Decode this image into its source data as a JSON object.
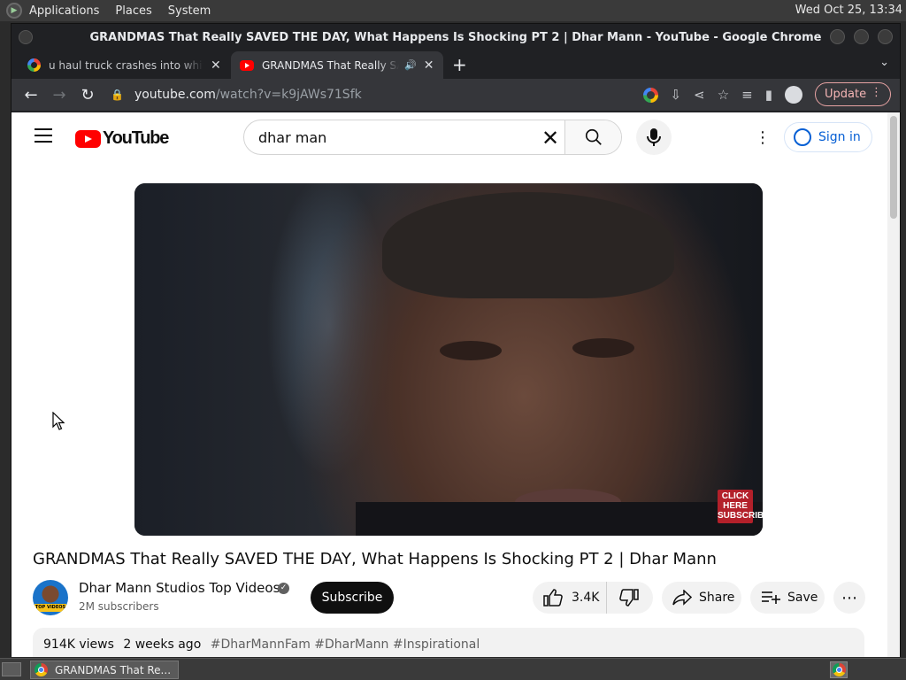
{
  "desktop": {
    "top_menus": [
      "Applications",
      "Places",
      "System"
    ],
    "clock": "Wed Oct 25, 13:34"
  },
  "window": {
    "title": "GRANDMAS That Really SAVED THE DAY, What Happens Is Shocking PT 2 | Dhar Mann - YouTube - Google Chrome"
  },
  "tabs": [
    {
      "title": "u haul truck crashes into white",
      "favicon": "google-icon",
      "active": false
    },
    {
      "title": "GRANDMAS That Really SAVED THE DAY",
      "favicon": "youtube-icon",
      "active": true
    }
  ],
  "toolbar": {
    "url_host": "youtube.com",
    "url_path": "/watch?v=k9jAWs71Sfk",
    "update_label": "Update"
  },
  "youtube": {
    "logo_text": "YouTube",
    "search_value": "dhar man",
    "sign_in_label": "Sign in",
    "player": {
      "badge_text": "CLICK HERE SUBSCRIBE"
    },
    "video": {
      "title": "GRANDMAS That Really SAVED THE DAY, What Happens Is Shocking PT 2 | Dhar Mann",
      "channel_name": "Dhar Mann Studios Top Videos",
      "subscribers": "2M subscribers",
      "avatar_badge": "TOP VIDEOS",
      "subscribe_label": "Subscribe",
      "likes": "3.4K",
      "share_label": "Share",
      "save_label": "Save",
      "views": "914K views",
      "age": "2 weeks ago",
      "hashtags": "#DharMannFam #DharMann #Inspirational"
    }
  },
  "taskbar": {
    "task_label": "GRANDMAS That Re..."
  },
  "colors": {
    "youtube_red": "#ff0000",
    "link_blue": "#065fd4",
    "chrome_dark": "#202124"
  }
}
